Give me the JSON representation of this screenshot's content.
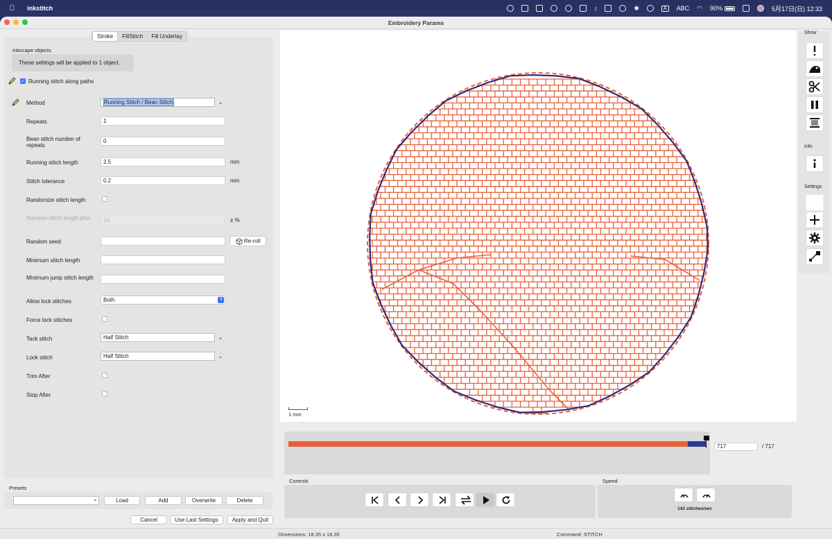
{
  "menubar": {
    "app_name": "inkstitch",
    "input_mode": "ABC",
    "battery": "90%",
    "datetime": "5月17日(日)  12:33"
  },
  "window": {
    "title": "Embroidery Params"
  },
  "tabs": [
    {
      "label": "Stroke",
      "active": true
    },
    {
      "label": "FillStitch",
      "active": false
    },
    {
      "label": "Fill Underlay",
      "active": false
    }
  ],
  "params": {
    "group_label": "Inkscape objects",
    "info_text": "These settings will be applied to 1 object.",
    "running_stitch_label": "Running stitch along paths",
    "running_stitch_enabled": true,
    "method": {
      "label": "Method",
      "value": "Running Stitch / Bean Stitch"
    },
    "repeats": {
      "label": "Repeats",
      "value": "1"
    },
    "bean_repeats": {
      "label": "Bean stitch number of repeats",
      "value": "0"
    },
    "running_length": {
      "label": "Running stitch length",
      "value": "2.5",
      "unit": "mm"
    },
    "tolerance": {
      "label": "Stitch tolerance",
      "value": "0.2",
      "unit": "mm"
    },
    "randomize": {
      "label": "Randomize stitch length",
      "checked": false
    },
    "random_jitter": {
      "label": "Random stitch length jitter",
      "value": "10",
      "unit": "± %"
    },
    "random_seed": {
      "label": "Random seed",
      "value": "",
      "button": "Re-roll"
    },
    "min_stitch": {
      "label": "Minimum stitch length",
      "value": ""
    },
    "min_jump": {
      "label": "Minimum jump stitch length",
      "value": ""
    },
    "allow_lock": {
      "label": "Allow lock stitches",
      "value": "Both"
    },
    "force_lock": {
      "label": "Force lock stitches",
      "checked": false
    },
    "tack": {
      "label": "Tack stitch",
      "value": "Half Stitch"
    },
    "lock": {
      "label": "Lock stitch",
      "value": "Half Stitch"
    },
    "trim_after": {
      "label": "Trim After",
      "checked": false
    },
    "stop_after": {
      "label": "Stop After",
      "checked": false
    }
  },
  "presets": {
    "label": "Presets",
    "selected": "",
    "load": "Load",
    "add": "Add",
    "overwrite": "Overwrite",
    "delete": "Delete"
  },
  "footer_buttons": {
    "cancel": "Cancel",
    "use_last": "Use Last Settings",
    "apply_quit": "Apply and Quit"
  },
  "preview": {
    "scale_label": "1 mm",
    "colors": {
      "fill": "#e8603a",
      "outline": "#2e2a7a"
    }
  },
  "timeline": {
    "current": "717",
    "total": "/ 717",
    "progress_fraction": 0.955,
    "colors": {
      "done": "#e8603a",
      "remaining": "#2e3a8c"
    }
  },
  "controls": {
    "label": "Controls"
  },
  "speed": {
    "label": "Speed",
    "value": "143 stitches/sec"
  },
  "sidebar": {
    "show_label": "Show",
    "info_label": "Info",
    "settings_label": "Settings"
  },
  "status": {
    "dimensions": "Dimensions: 18.35 x 18.35",
    "command": "Command: STITCH"
  }
}
